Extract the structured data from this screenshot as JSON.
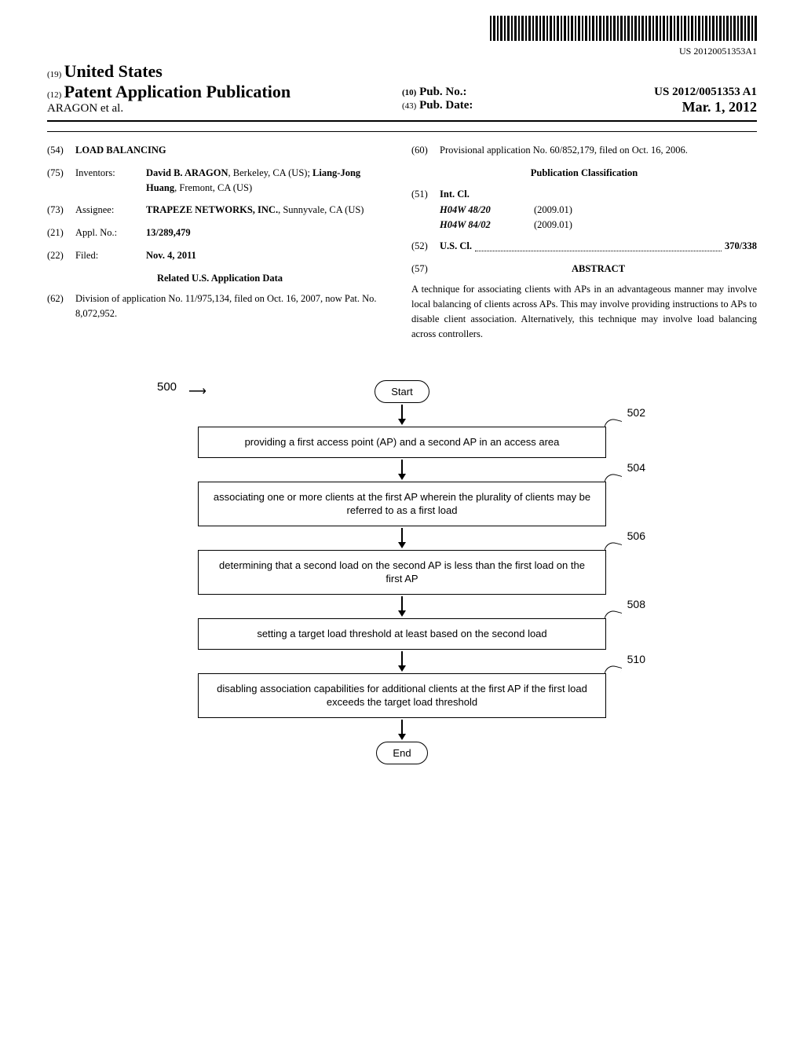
{
  "barcode_label": "US 20120051353A1",
  "header": {
    "prefix19": "(19)",
    "country": "United States",
    "prefix12": "(12)",
    "doc_type": "Patent Application Publication",
    "authors": "ARAGON et al.",
    "prefix10": "(10)",
    "pub_no_label": "Pub. No.:",
    "pub_no": "US 2012/0051353 A1",
    "prefix43": "(43)",
    "pub_date_label": "Pub. Date:",
    "pub_date": "Mar. 1, 2012"
  },
  "left": {
    "title_code": "(54)",
    "title": "LOAD BALANCING",
    "inventors_code": "(75)",
    "inventors_label": "Inventors:",
    "inventors_value_1": "David B. ARAGON",
    "inventors_value_1_loc": ", Berkeley, CA (US); ",
    "inventors_value_2": "Liang-Jong Huang",
    "inventors_value_2_loc": ", Fremont, CA (US)",
    "assignee_code": "(73)",
    "assignee_label": "Assignee:",
    "assignee_value": "TRAPEZE NETWORKS, INC.",
    "assignee_loc": ", Sunnyvale, CA (US)",
    "appl_code": "(21)",
    "appl_label": "Appl. No.:",
    "appl_value": "13/289,479",
    "filed_code": "(22)",
    "filed_label": "Filed:",
    "filed_value": "Nov. 4, 2011",
    "related_title": "Related U.S. Application Data",
    "div_code": "(62)",
    "div_text": "Division of application No. 11/975,134, filed on Oct. 16, 2007, now Pat. No. 8,072,952."
  },
  "right": {
    "prov_code": "(60)",
    "prov_text": "Provisional application No. 60/852,179, filed on Oct. 16, 2006.",
    "classification_title": "Publication Classification",
    "intcl_code": "(51)",
    "intcl_label": "Int. Cl.",
    "intcl_1": "H04W 48/20",
    "intcl_1_ver": "(2009.01)",
    "intcl_2": "H04W 84/02",
    "intcl_2_ver": "(2009.01)",
    "uscl_code": "(52)",
    "uscl_label": "U.S. Cl.",
    "uscl_value": "370/338",
    "abstract_code": "(57)",
    "abstract_label": "ABSTRACT",
    "abstract_text": "A technique for associating clients with APs in an advantageous manner may involve local balancing of clients across APs. This may involve providing instructions to APs to disable client association. Alternatively, this technique may involve load balancing across controllers."
  },
  "figure": {
    "ref": "500",
    "start": "Start",
    "end": "End",
    "steps": [
      {
        "num": "502",
        "text": "providing a first access point (AP) and a second AP in an access area"
      },
      {
        "num": "504",
        "text": "associating one or more clients at the first AP wherein the plurality of clients may be referred to as a first load"
      },
      {
        "num": "506",
        "text": "determining that a second load on the second AP is less than the first load on the first AP"
      },
      {
        "num": "508",
        "text": "setting a target load threshold at least based on the second load"
      },
      {
        "num": "510",
        "text": "disabling association capabilities for additional clients at the first AP if the first load exceeds the target load threshold"
      }
    ]
  }
}
